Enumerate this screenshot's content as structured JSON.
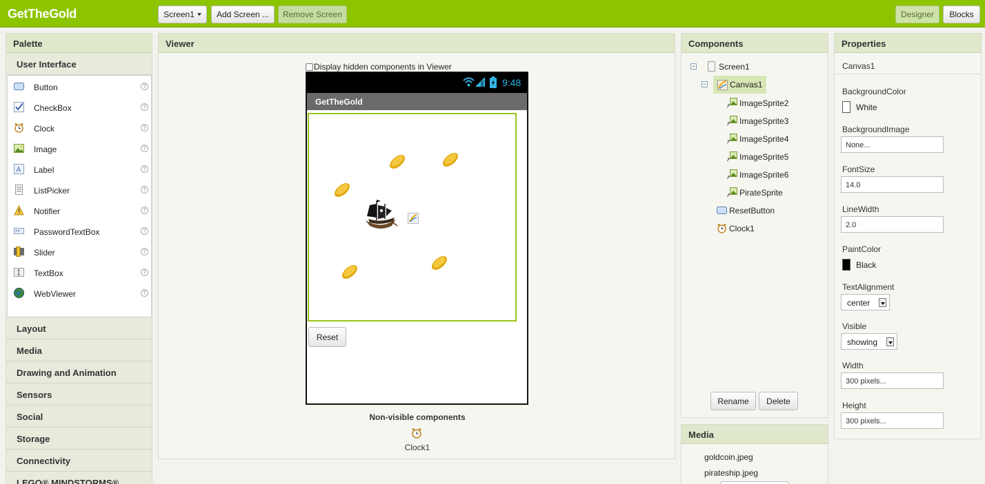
{
  "app": {
    "title": "GetTheGold"
  },
  "toolbar": {
    "screen_select": "Screen1",
    "add_screen": "Add Screen ...",
    "remove_screen": "Remove Screen",
    "designer": "Designer",
    "blocks": "Blocks"
  },
  "palette": {
    "header": "Palette",
    "open_category": "User Interface",
    "items": [
      {
        "label": "Button",
        "icon": "button-icon"
      },
      {
        "label": "CheckBox",
        "icon": "checkbox-icon"
      },
      {
        "label": "Clock",
        "icon": "clock-icon"
      },
      {
        "label": "Image",
        "icon": "image-icon"
      },
      {
        "label": "Label",
        "icon": "label-icon"
      },
      {
        "label": "ListPicker",
        "icon": "listpicker-icon"
      },
      {
        "label": "Notifier",
        "icon": "notifier-icon"
      },
      {
        "label": "PasswordTextBox",
        "icon": "password-icon"
      },
      {
        "label": "Slider",
        "icon": "slider-icon"
      },
      {
        "label": "TextBox",
        "icon": "textbox-icon"
      },
      {
        "label": "WebViewer",
        "icon": "webviewer-icon"
      }
    ],
    "help_glyph": "?",
    "categories": [
      "Layout",
      "Media",
      "Drawing and Animation",
      "Sensors",
      "Social",
      "Storage",
      "Connectivity",
      "LEGO® MINDSTORMS®"
    ]
  },
  "viewer": {
    "header": "Viewer",
    "hidden_checkbox_label": "Display hidden components in Viewer",
    "status_time": "9:48",
    "screen_title": "GetTheGold",
    "reset_button": "Reset",
    "nonvisible_title": "Non-visible components",
    "nonvisible_items": [
      "Clock1"
    ]
  },
  "components": {
    "header": "Components",
    "tree": {
      "screen": "Screen1",
      "canvas": "Canvas1",
      "sprites": [
        "ImageSprite2",
        "ImageSprite3",
        "ImageSprite4",
        "ImageSprite5",
        "ImageSprite6",
        "PirateSprite"
      ],
      "reset": "ResetButton",
      "clock": "Clock1"
    },
    "collapse_glyph": "−",
    "rename": "Rename",
    "delete": "Delete"
  },
  "media": {
    "header": "Media",
    "files": [
      "goldcoin.jpeg",
      "pirateship.jpeg"
    ]
  },
  "properties": {
    "header": "Properties",
    "component": "Canvas1",
    "background_color_label": "BackgroundColor",
    "background_color_value": "White",
    "background_image_label": "BackgroundImage",
    "background_image_value": "None...",
    "font_size_label": "FontSize",
    "font_size_value": "14.0",
    "line_width_label": "LineWidth",
    "line_width_value": "2.0",
    "paint_color_label": "PaintColor",
    "paint_color_value": "Black",
    "text_alignment_label": "TextAlignment",
    "text_alignment_value": "center",
    "visible_label": "Visible",
    "visible_value": "showing",
    "width_label": "Width",
    "width_value": "300 pixels...",
    "height_label": "Height",
    "height_value": "300 pixels..."
  },
  "colors": {
    "brand": "#8dc400",
    "panel_header": "#dfe8cb",
    "selected": "#d7e6b5"
  }
}
